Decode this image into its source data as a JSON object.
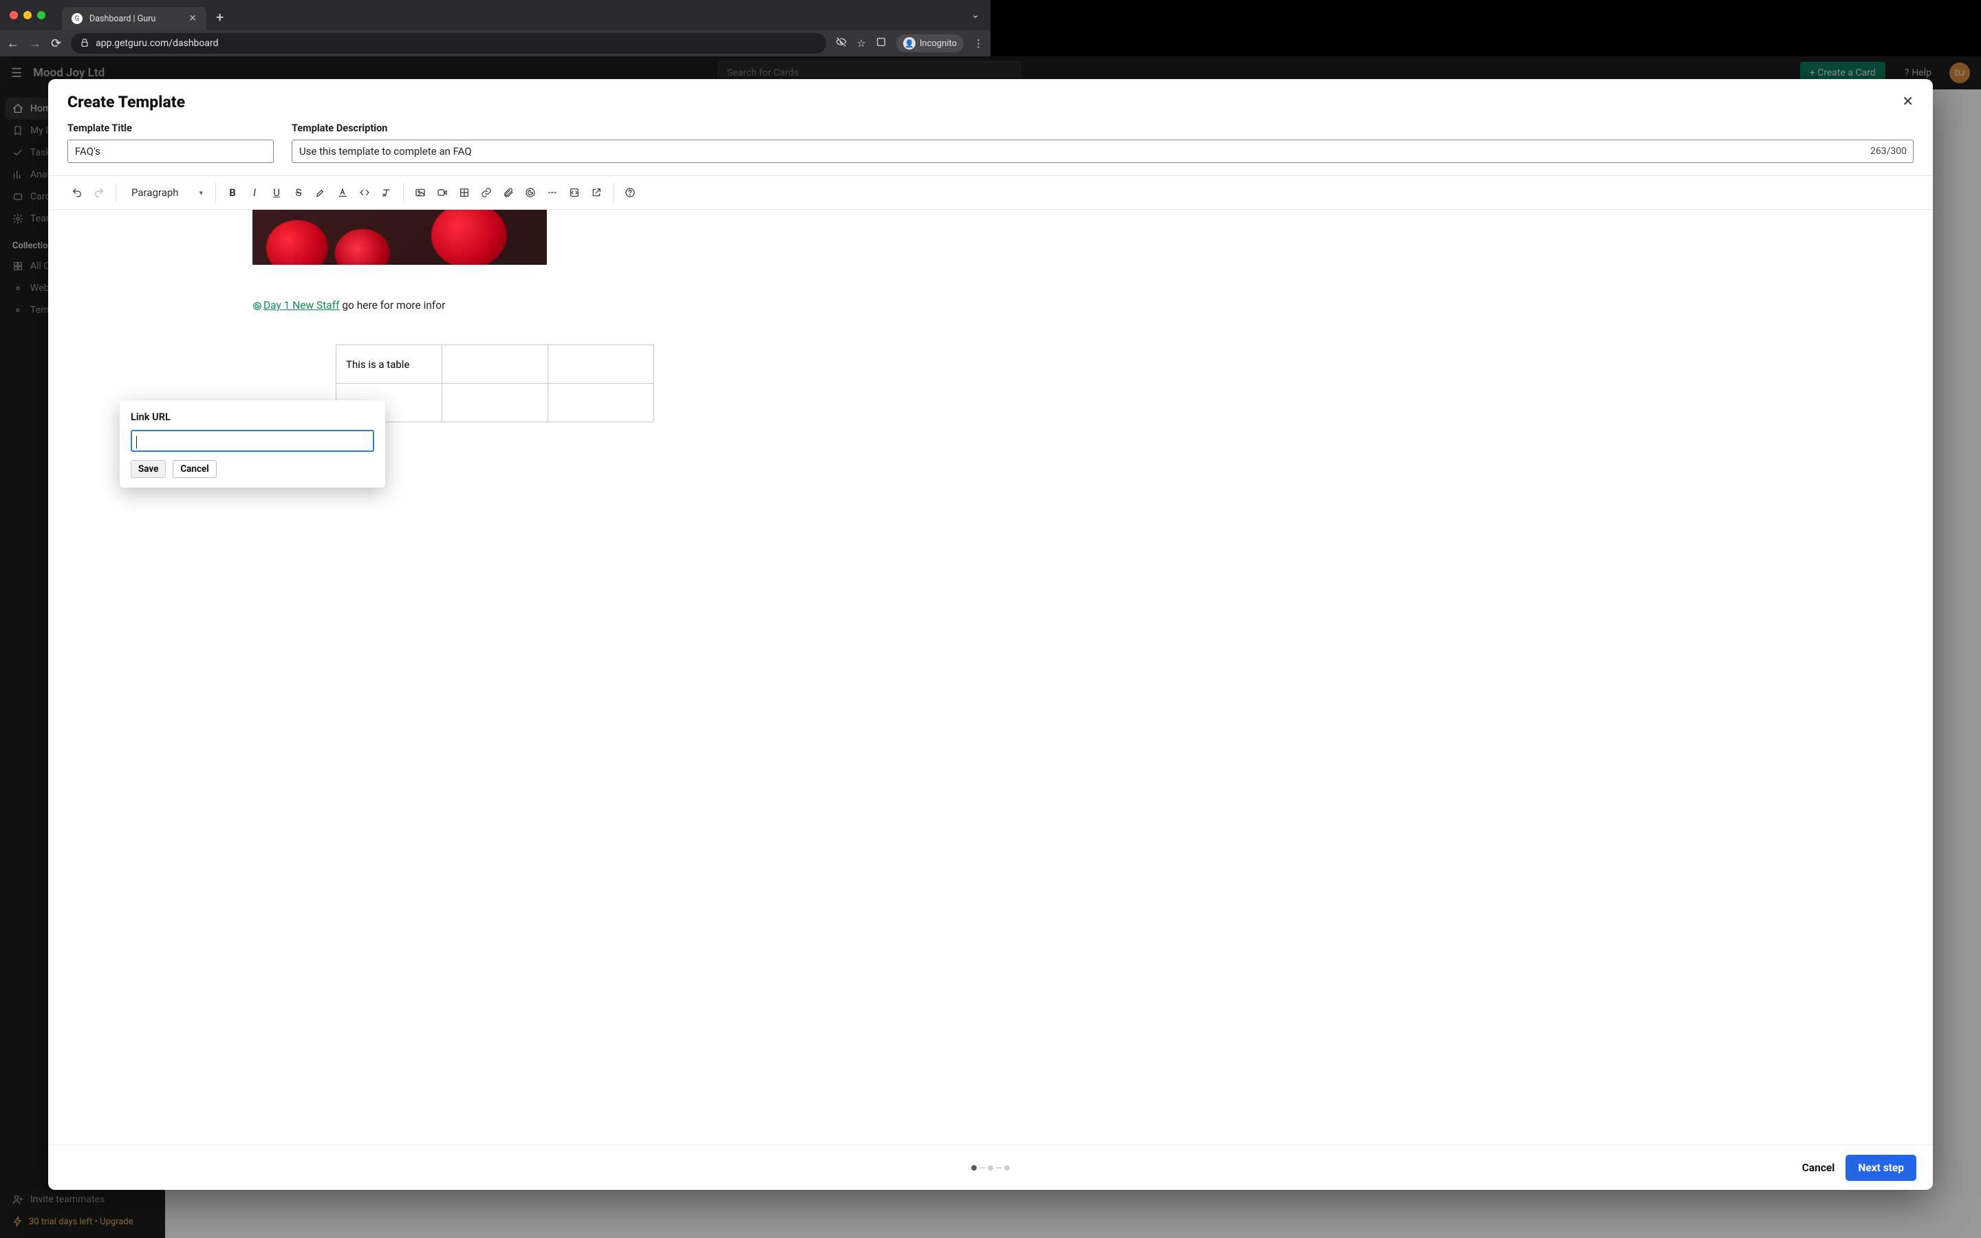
{
  "browser": {
    "tab_title": "Dashboard | Guru",
    "url": "app.getguru.com/dashboard",
    "incognito_label": "Incognito"
  },
  "app": {
    "brand": "Mood Joy Ltd",
    "search_placeholder": "Search for Cards",
    "create_card": "+  Create a Card",
    "help": "Help",
    "avatar_initials": "DJ",
    "trial_text": "30 trial days left • Upgrade",
    "sidebar": {
      "items": [
        {
          "label": "Home"
        },
        {
          "label": "My Library"
        },
        {
          "label": "Tasks"
        },
        {
          "label": "Analytics"
        },
        {
          "label": "Card Manager"
        },
        {
          "label": "Team Settings"
        }
      ],
      "collections_heading": "Collections",
      "collections": [
        {
          "label": "All Collections"
        },
        {
          "label": "Website"
        },
        {
          "label": "Templates"
        }
      ],
      "invite": "Invite teammates"
    }
  },
  "modal": {
    "title": "Create Template",
    "title_label": "Template Title",
    "title_value": "FAQ's",
    "desc_label": "Template Description",
    "desc_value": "Use this template to complete an FAQ",
    "desc_counter": "263/300",
    "format_label": "Paragraph",
    "content": {
      "link_text": "Day 1 New Staff",
      "after_link": " go here for more infor",
      "table_cell": "This is a table"
    },
    "link_popover": {
      "label": "Link URL",
      "value": "",
      "save": "Save",
      "cancel": "Cancel"
    },
    "footer": {
      "cancel": "Cancel",
      "next": "Next step"
    }
  }
}
